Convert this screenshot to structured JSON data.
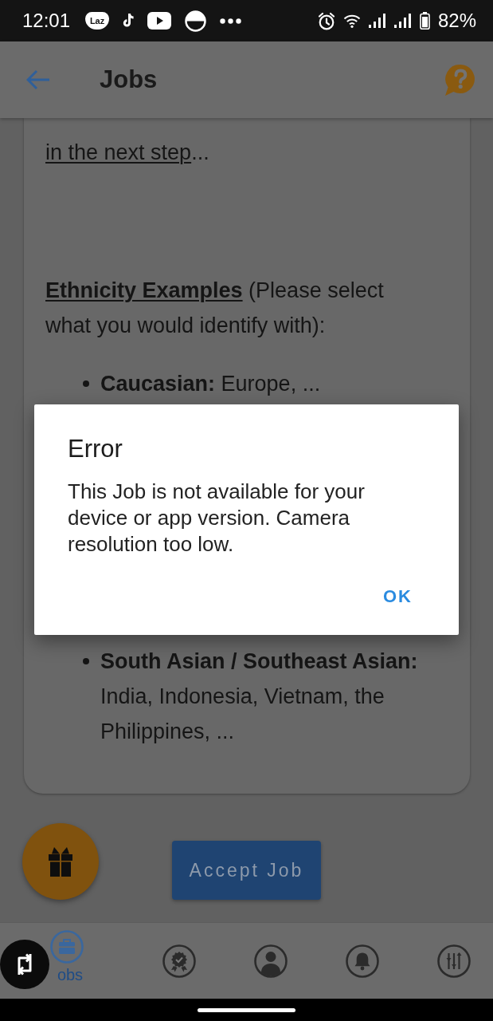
{
  "status_bar": {
    "time": "12:01",
    "app_logo": "Laz",
    "battery": "82%"
  },
  "app_bar": {
    "title": "Jobs"
  },
  "card": {
    "intro": [
      {
        "text": "in the next step",
        "bold": false,
        "underline": true
      },
      {
        "text": "...",
        "bold": false,
        "underline": false
      }
    ],
    "examples_heading": [
      {
        "text": "Ethnicity Examples",
        "bold": true,
        "underline": true
      },
      {
        "text": " (Please select what you would identify with):",
        "bold": false,
        "underline": false
      }
    ],
    "examples": [
      "**Caucasian:** Europe, ...",
      "**South Asian / Southeast Asian:** India, Indonesia, Vietnam, the Philippines, ..."
    ]
  },
  "accept_button": {
    "label": "Accept Job"
  },
  "bottom_nav": [
    {
      "kind": "briefcase",
      "label": "obs",
      "selected": true
    },
    {
      "kind": "award",
      "selected": false
    },
    {
      "kind": "person",
      "selected": false
    },
    {
      "kind": "bell",
      "selected": false
    },
    {
      "kind": "sliders",
      "selected": false
    }
  ],
  "dialog": {
    "title": "Error",
    "message": "This Job is not available for your device or app version. Camera resolution too low.",
    "button": "OK"
  }
}
